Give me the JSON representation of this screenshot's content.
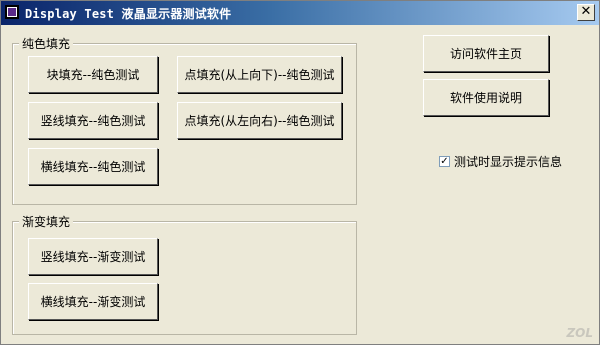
{
  "window": {
    "title": "Display Test 液晶显示器测试软件",
    "close_glyph": "✕"
  },
  "solid_group": {
    "label": "纯色填充",
    "buttons": [
      "块填充--纯色测试",
      "点填充(从上向下)--纯色测试",
      "竖线填充--纯色测试",
      "点填充(从左向右)--纯色测试",
      "横线填充--纯色测试"
    ]
  },
  "gradient_group": {
    "label": "渐变填充",
    "buttons": [
      "竖线填充--渐变测试",
      "横线填充--渐变测试"
    ]
  },
  "right_panel": {
    "visit_homepage": "访问软件主页",
    "usage_help": "软件使用说明",
    "show_info_checkbox": {
      "label": "测试时显示提示信息",
      "checked": true,
      "mark": "✓"
    }
  },
  "watermark": "ZOL"
}
